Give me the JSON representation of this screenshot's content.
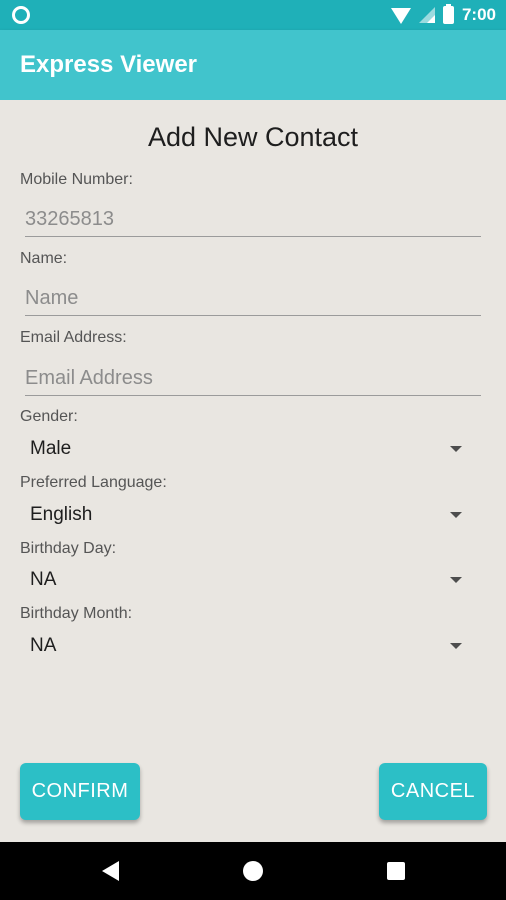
{
  "status_bar": {
    "time": "7:00"
  },
  "app_bar": {
    "title": "Express Viewer"
  },
  "form": {
    "title": "Add New Contact",
    "mobile": {
      "label": "Mobile Number:",
      "placeholder": "33265813"
    },
    "name": {
      "label": "Name:",
      "placeholder": "Name"
    },
    "email": {
      "label": "Email Address:",
      "placeholder": "Email Address"
    },
    "gender": {
      "label": "Gender:",
      "value": "Male"
    },
    "language": {
      "label": "Preferred Language:",
      "value": "English"
    },
    "birthday_day": {
      "label": "Birthday Day:",
      "value": "NA"
    },
    "birthday_month": {
      "label": "Birthday Month:",
      "value": "NA"
    }
  },
  "buttons": {
    "confirm": "CONFIRM",
    "cancel": "CANCEL"
  },
  "icons": [
    "app-status-icon",
    "wifi-icon",
    "signal-icon",
    "battery-icon",
    "back-icon",
    "home-icon",
    "recents-icon",
    "dropdown-caret-icon"
  ],
  "colors": {
    "status_bar": "#1fb0b8",
    "app_bar": "#41c4cc",
    "button": "#2cbfc6"
  }
}
